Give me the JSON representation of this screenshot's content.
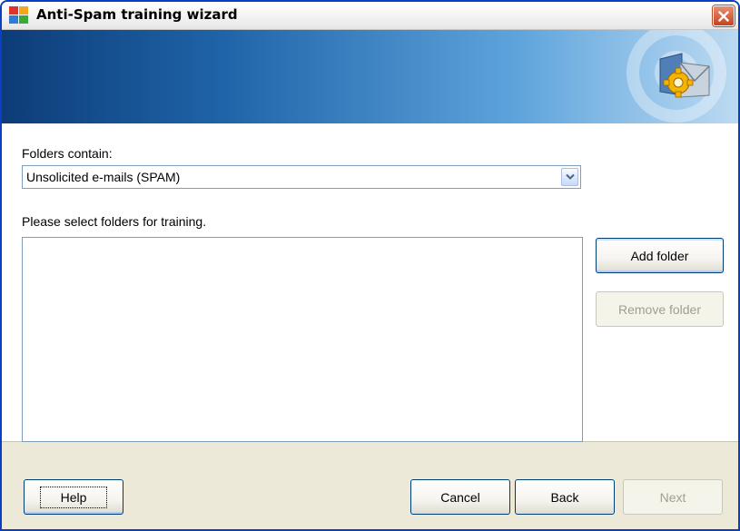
{
  "window": {
    "title": "Anti-Spam training wizard",
    "close_icon": "close-icon",
    "app_icon": "avg-logo-icon",
    "banner_icon": "mail-gear-shield-icon"
  },
  "form": {
    "folders_contain_label": "Folders contain:",
    "folders_contain_value": "Unsolicited e-mails (SPAM)",
    "select_folders_label": "Please select folders for training.",
    "folder_list_items": []
  },
  "side_buttons": {
    "add_folder": "Add folder",
    "remove_folder": "Remove folder"
  },
  "footer": {
    "help": "Help",
    "cancel": "Cancel",
    "back": "Back",
    "next": "Next"
  },
  "colors": {
    "title_border": "#0a3fc4",
    "banner_dark": "#0d3c78",
    "banner_light": "#bcdaf2",
    "close_red": "#c6431d",
    "dialog_face": "#ece9d8"
  }
}
